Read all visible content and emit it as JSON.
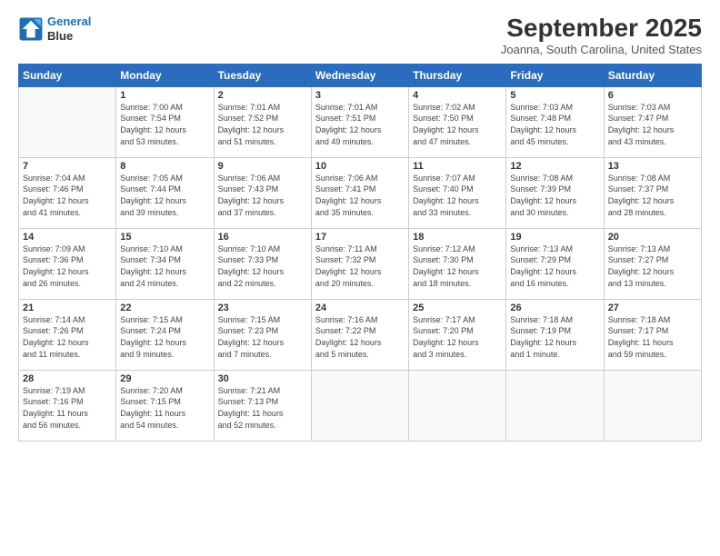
{
  "header": {
    "logo_line1": "General",
    "logo_line2": "Blue",
    "month": "September 2025",
    "location": "Joanna, South Carolina, United States"
  },
  "days_of_week": [
    "Sunday",
    "Monday",
    "Tuesday",
    "Wednesday",
    "Thursday",
    "Friday",
    "Saturday"
  ],
  "weeks": [
    [
      {
        "day": "",
        "info": ""
      },
      {
        "day": "1",
        "info": "Sunrise: 7:00 AM\nSunset: 7:54 PM\nDaylight: 12 hours\nand 53 minutes."
      },
      {
        "day": "2",
        "info": "Sunrise: 7:01 AM\nSunset: 7:52 PM\nDaylight: 12 hours\nand 51 minutes."
      },
      {
        "day": "3",
        "info": "Sunrise: 7:01 AM\nSunset: 7:51 PM\nDaylight: 12 hours\nand 49 minutes."
      },
      {
        "day": "4",
        "info": "Sunrise: 7:02 AM\nSunset: 7:50 PM\nDaylight: 12 hours\nand 47 minutes."
      },
      {
        "day": "5",
        "info": "Sunrise: 7:03 AM\nSunset: 7:48 PM\nDaylight: 12 hours\nand 45 minutes."
      },
      {
        "day": "6",
        "info": "Sunrise: 7:03 AM\nSunset: 7:47 PM\nDaylight: 12 hours\nand 43 minutes."
      }
    ],
    [
      {
        "day": "7",
        "info": "Sunrise: 7:04 AM\nSunset: 7:46 PM\nDaylight: 12 hours\nand 41 minutes."
      },
      {
        "day": "8",
        "info": "Sunrise: 7:05 AM\nSunset: 7:44 PM\nDaylight: 12 hours\nand 39 minutes."
      },
      {
        "day": "9",
        "info": "Sunrise: 7:06 AM\nSunset: 7:43 PM\nDaylight: 12 hours\nand 37 minutes."
      },
      {
        "day": "10",
        "info": "Sunrise: 7:06 AM\nSunset: 7:41 PM\nDaylight: 12 hours\nand 35 minutes."
      },
      {
        "day": "11",
        "info": "Sunrise: 7:07 AM\nSunset: 7:40 PM\nDaylight: 12 hours\nand 33 minutes."
      },
      {
        "day": "12",
        "info": "Sunrise: 7:08 AM\nSunset: 7:39 PM\nDaylight: 12 hours\nand 30 minutes."
      },
      {
        "day": "13",
        "info": "Sunrise: 7:08 AM\nSunset: 7:37 PM\nDaylight: 12 hours\nand 28 minutes."
      }
    ],
    [
      {
        "day": "14",
        "info": "Sunrise: 7:09 AM\nSunset: 7:36 PM\nDaylight: 12 hours\nand 26 minutes."
      },
      {
        "day": "15",
        "info": "Sunrise: 7:10 AM\nSunset: 7:34 PM\nDaylight: 12 hours\nand 24 minutes."
      },
      {
        "day": "16",
        "info": "Sunrise: 7:10 AM\nSunset: 7:33 PM\nDaylight: 12 hours\nand 22 minutes."
      },
      {
        "day": "17",
        "info": "Sunrise: 7:11 AM\nSunset: 7:32 PM\nDaylight: 12 hours\nand 20 minutes."
      },
      {
        "day": "18",
        "info": "Sunrise: 7:12 AM\nSunset: 7:30 PM\nDaylight: 12 hours\nand 18 minutes."
      },
      {
        "day": "19",
        "info": "Sunrise: 7:13 AM\nSunset: 7:29 PM\nDaylight: 12 hours\nand 16 minutes."
      },
      {
        "day": "20",
        "info": "Sunrise: 7:13 AM\nSunset: 7:27 PM\nDaylight: 12 hours\nand 13 minutes."
      }
    ],
    [
      {
        "day": "21",
        "info": "Sunrise: 7:14 AM\nSunset: 7:26 PM\nDaylight: 12 hours\nand 11 minutes."
      },
      {
        "day": "22",
        "info": "Sunrise: 7:15 AM\nSunset: 7:24 PM\nDaylight: 12 hours\nand 9 minutes."
      },
      {
        "day": "23",
        "info": "Sunrise: 7:15 AM\nSunset: 7:23 PM\nDaylight: 12 hours\nand 7 minutes."
      },
      {
        "day": "24",
        "info": "Sunrise: 7:16 AM\nSunset: 7:22 PM\nDaylight: 12 hours\nand 5 minutes."
      },
      {
        "day": "25",
        "info": "Sunrise: 7:17 AM\nSunset: 7:20 PM\nDaylight: 12 hours\nand 3 minutes."
      },
      {
        "day": "26",
        "info": "Sunrise: 7:18 AM\nSunset: 7:19 PM\nDaylight: 12 hours\nand 1 minute."
      },
      {
        "day": "27",
        "info": "Sunrise: 7:18 AM\nSunset: 7:17 PM\nDaylight: 11 hours\nand 59 minutes."
      }
    ],
    [
      {
        "day": "28",
        "info": "Sunrise: 7:19 AM\nSunset: 7:16 PM\nDaylight: 11 hours\nand 56 minutes."
      },
      {
        "day": "29",
        "info": "Sunrise: 7:20 AM\nSunset: 7:15 PM\nDaylight: 11 hours\nand 54 minutes."
      },
      {
        "day": "30",
        "info": "Sunrise: 7:21 AM\nSunset: 7:13 PM\nDaylight: 11 hours\nand 52 minutes."
      },
      {
        "day": "",
        "info": ""
      },
      {
        "day": "",
        "info": ""
      },
      {
        "day": "",
        "info": ""
      },
      {
        "day": "",
        "info": ""
      }
    ]
  ]
}
